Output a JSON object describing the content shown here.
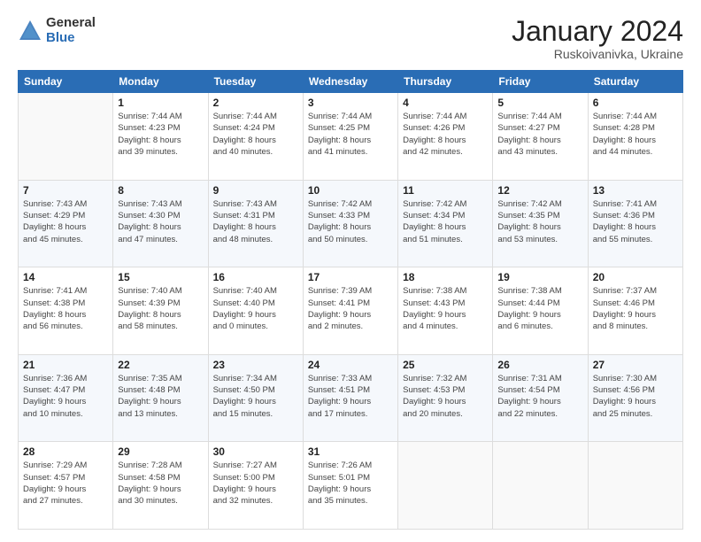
{
  "header": {
    "logo_general": "General",
    "logo_blue": "Blue",
    "title": "January 2024",
    "location": "Ruskoivanivka, Ukraine"
  },
  "days_of_week": [
    "Sunday",
    "Monday",
    "Tuesday",
    "Wednesday",
    "Thursday",
    "Friday",
    "Saturday"
  ],
  "weeks": [
    [
      {
        "day": "",
        "info": ""
      },
      {
        "day": "1",
        "info": "Sunrise: 7:44 AM\nSunset: 4:23 PM\nDaylight: 8 hours\nand 39 minutes."
      },
      {
        "day": "2",
        "info": "Sunrise: 7:44 AM\nSunset: 4:24 PM\nDaylight: 8 hours\nand 40 minutes."
      },
      {
        "day": "3",
        "info": "Sunrise: 7:44 AM\nSunset: 4:25 PM\nDaylight: 8 hours\nand 41 minutes."
      },
      {
        "day": "4",
        "info": "Sunrise: 7:44 AM\nSunset: 4:26 PM\nDaylight: 8 hours\nand 42 minutes."
      },
      {
        "day": "5",
        "info": "Sunrise: 7:44 AM\nSunset: 4:27 PM\nDaylight: 8 hours\nand 43 minutes."
      },
      {
        "day": "6",
        "info": "Sunrise: 7:44 AM\nSunset: 4:28 PM\nDaylight: 8 hours\nand 44 minutes."
      }
    ],
    [
      {
        "day": "7",
        "info": "Sunrise: 7:43 AM\nSunset: 4:29 PM\nDaylight: 8 hours\nand 45 minutes."
      },
      {
        "day": "8",
        "info": "Sunrise: 7:43 AM\nSunset: 4:30 PM\nDaylight: 8 hours\nand 47 minutes."
      },
      {
        "day": "9",
        "info": "Sunrise: 7:43 AM\nSunset: 4:31 PM\nDaylight: 8 hours\nand 48 minutes."
      },
      {
        "day": "10",
        "info": "Sunrise: 7:42 AM\nSunset: 4:33 PM\nDaylight: 8 hours\nand 50 minutes."
      },
      {
        "day": "11",
        "info": "Sunrise: 7:42 AM\nSunset: 4:34 PM\nDaylight: 8 hours\nand 51 minutes."
      },
      {
        "day": "12",
        "info": "Sunrise: 7:42 AM\nSunset: 4:35 PM\nDaylight: 8 hours\nand 53 minutes."
      },
      {
        "day": "13",
        "info": "Sunrise: 7:41 AM\nSunset: 4:36 PM\nDaylight: 8 hours\nand 55 minutes."
      }
    ],
    [
      {
        "day": "14",
        "info": "Sunrise: 7:41 AM\nSunset: 4:38 PM\nDaylight: 8 hours\nand 56 minutes."
      },
      {
        "day": "15",
        "info": "Sunrise: 7:40 AM\nSunset: 4:39 PM\nDaylight: 8 hours\nand 58 minutes."
      },
      {
        "day": "16",
        "info": "Sunrise: 7:40 AM\nSunset: 4:40 PM\nDaylight: 9 hours\nand 0 minutes."
      },
      {
        "day": "17",
        "info": "Sunrise: 7:39 AM\nSunset: 4:41 PM\nDaylight: 9 hours\nand 2 minutes."
      },
      {
        "day": "18",
        "info": "Sunrise: 7:38 AM\nSunset: 4:43 PM\nDaylight: 9 hours\nand 4 minutes."
      },
      {
        "day": "19",
        "info": "Sunrise: 7:38 AM\nSunset: 4:44 PM\nDaylight: 9 hours\nand 6 minutes."
      },
      {
        "day": "20",
        "info": "Sunrise: 7:37 AM\nSunset: 4:46 PM\nDaylight: 9 hours\nand 8 minutes."
      }
    ],
    [
      {
        "day": "21",
        "info": "Sunrise: 7:36 AM\nSunset: 4:47 PM\nDaylight: 9 hours\nand 10 minutes."
      },
      {
        "day": "22",
        "info": "Sunrise: 7:35 AM\nSunset: 4:48 PM\nDaylight: 9 hours\nand 13 minutes."
      },
      {
        "day": "23",
        "info": "Sunrise: 7:34 AM\nSunset: 4:50 PM\nDaylight: 9 hours\nand 15 minutes."
      },
      {
        "day": "24",
        "info": "Sunrise: 7:33 AM\nSunset: 4:51 PM\nDaylight: 9 hours\nand 17 minutes."
      },
      {
        "day": "25",
        "info": "Sunrise: 7:32 AM\nSunset: 4:53 PM\nDaylight: 9 hours\nand 20 minutes."
      },
      {
        "day": "26",
        "info": "Sunrise: 7:31 AM\nSunset: 4:54 PM\nDaylight: 9 hours\nand 22 minutes."
      },
      {
        "day": "27",
        "info": "Sunrise: 7:30 AM\nSunset: 4:56 PM\nDaylight: 9 hours\nand 25 minutes."
      }
    ],
    [
      {
        "day": "28",
        "info": "Sunrise: 7:29 AM\nSunset: 4:57 PM\nDaylight: 9 hours\nand 27 minutes."
      },
      {
        "day": "29",
        "info": "Sunrise: 7:28 AM\nSunset: 4:58 PM\nDaylight: 9 hours\nand 30 minutes."
      },
      {
        "day": "30",
        "info": "Sunrise: 7:27 AM\nSunset: 5:00 PM\nDaylight: 9 hours\nand 32 minutes."
      },
      {
        "day": "31",
        "info": "Sunrise: 7:26 AM\nSunset: 5:01 PM\nDaylight: 9 hours\nand 35 minutes."
      },
      {
        "day": "",
        "info": ""
      },
      {
        "day": "",
        "info": ""
      },
      {
        "day": "",
        "info": ""
      }
    ]
  ]
}
